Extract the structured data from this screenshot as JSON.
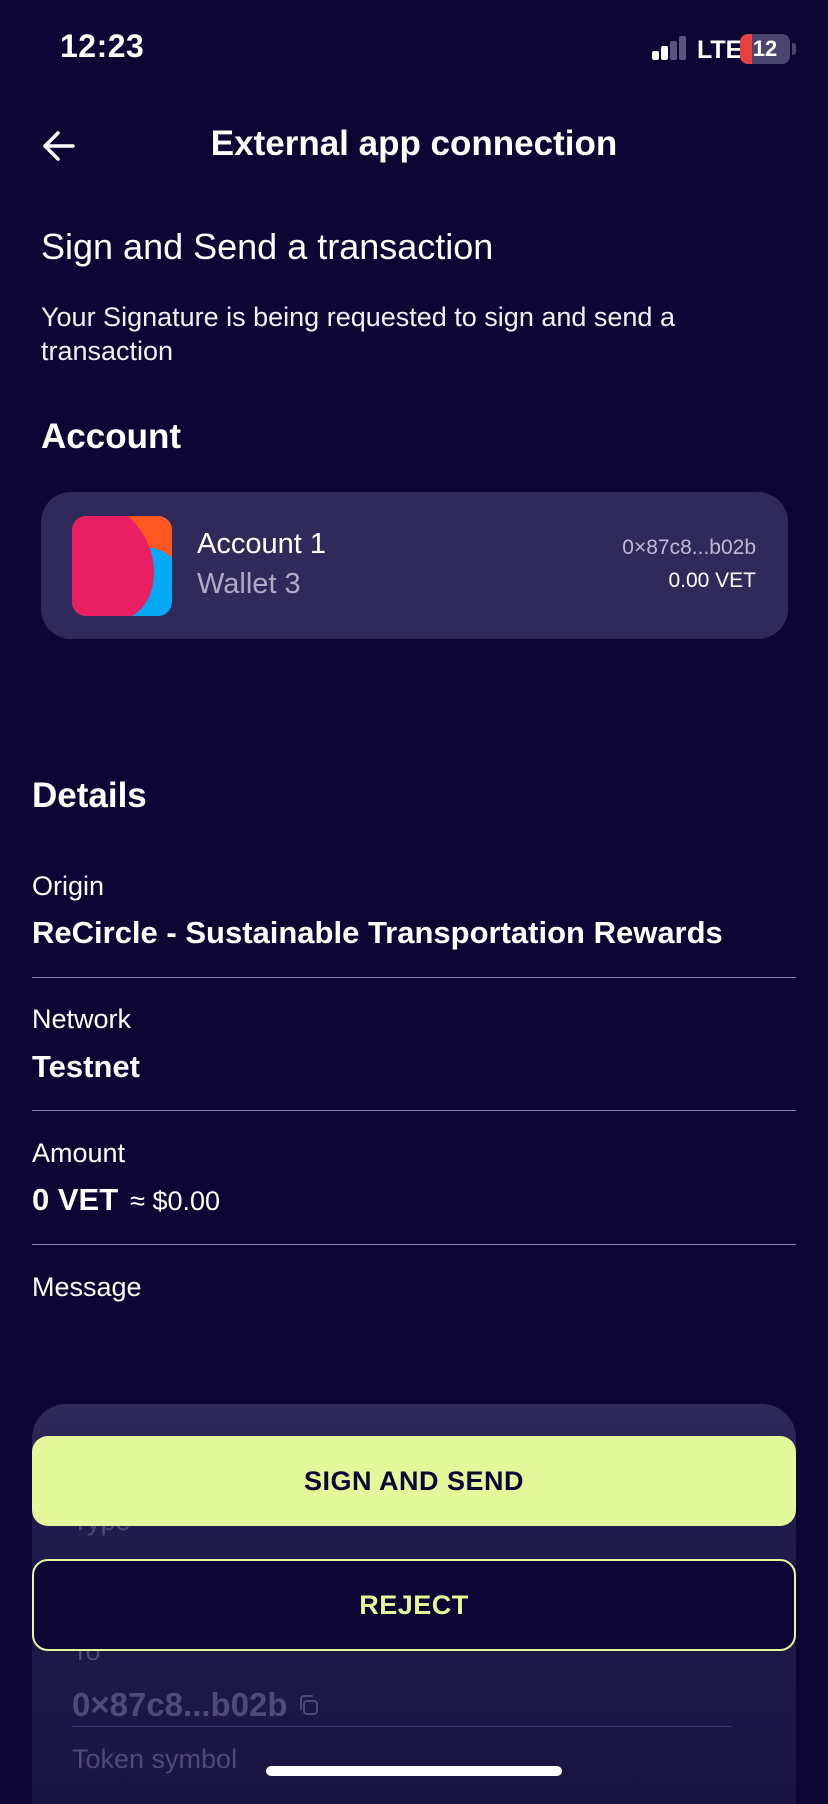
{
  "status_bar": {
    "time": "12:23",
    "network": "LTE",
    "battery_level": "12",
    "battery_fraction": 0.12,
    "signal_bars_active": 2,
    "signal_bars_total": 4
  },
  "header": {
    "back_icon": "arrow-left-icon",
    "title": "External app connection"
  },
  "request": {
    "title": "Sign and Send a transaction",
    "description": "Your Signature is being requested to sign and send a transaction"
  },
  "account": {
    "heading": "Account",
    "name": "Account 1",
    "wallet": "Wallet 3",
    "address": "0×87c8...b02b",
    "balance": "0.00 VET",
    "avatar_colors": [
      "#e91e63",
      "#ff5722",
      "#03a9f4"
    ]
  },
  "details": {
    "heading": "Details",
    "origin_label": "Origin",
    "origin_value": "ReCircle - Sustainable Transportation Rewards",
    "network_label": "Network",
    "network_value": "Testnet",
    "amount_label": "Amount",
    "amount_value": "0 VET",
    "amount_fiat": "≈ $0.00",
    "message_label": "Message"
  },
  "sheet": {
    "type_label": "Type",
    "to_label": "To",
    "to_value": "0×87c8...b02b",
    "copy_icon": "copy-icon",
    "token_label": "Token symbol"
  },
  "actions": {
    "sign_label": "SIGN AND SEND",
    "reject_label": "REJECT"
  },
  "colors": {
    "background": "#0d0634",
    "card": "#2f2a5a",
    "accent": "#e2f89a"
  }
}
